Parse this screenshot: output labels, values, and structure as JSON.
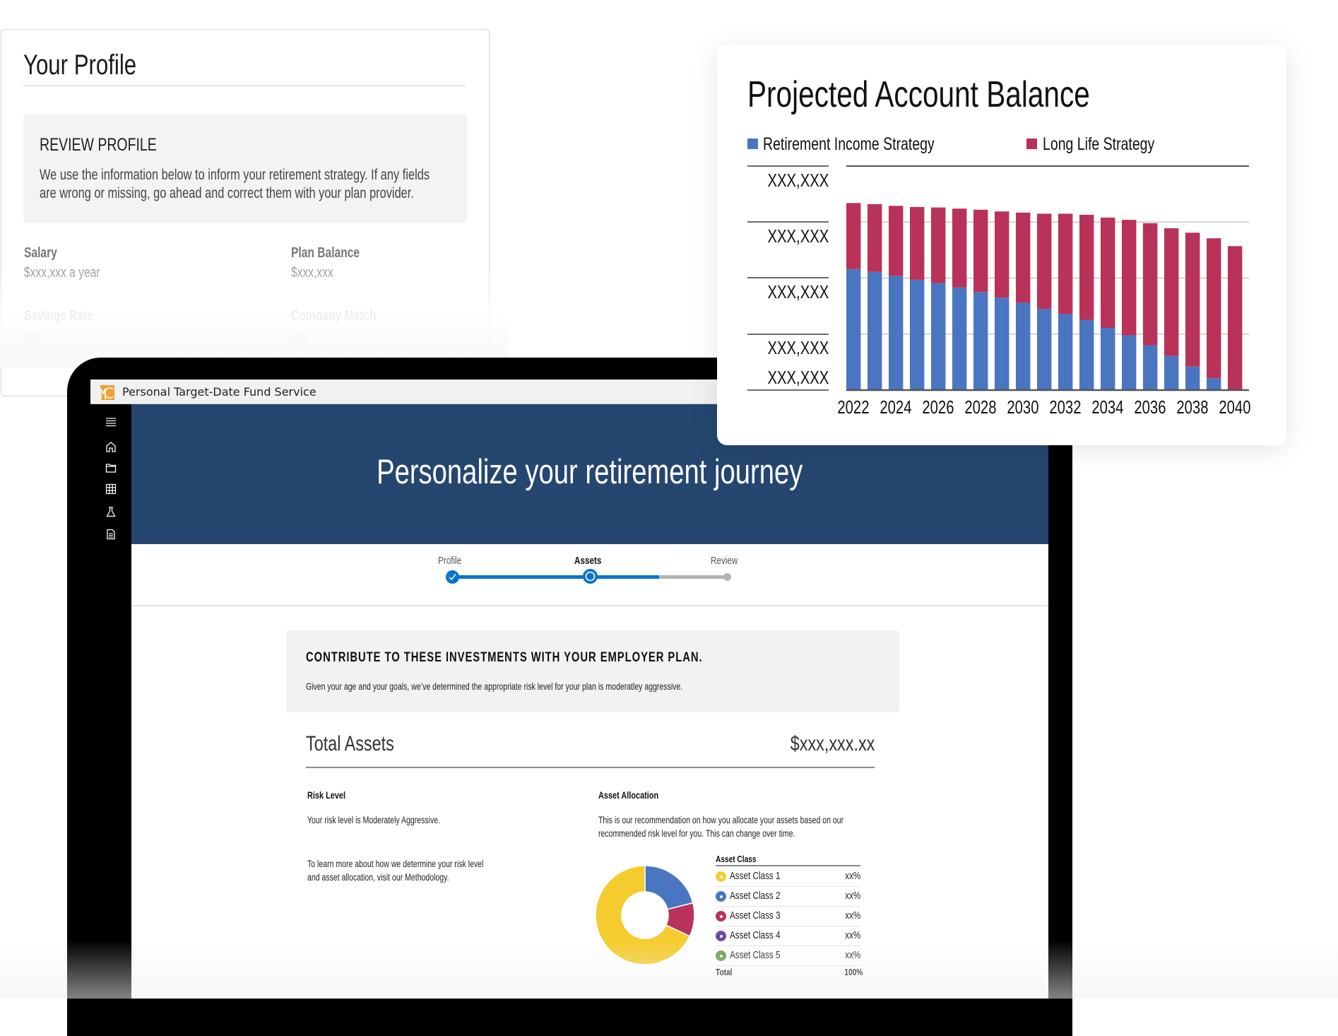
{
  "profile_card": {
    "title": "Your Profile",
    "review_title": "REVIEW PROFILE",
    "review_desc_line1": "We use the information below to inform your retirement strategy. If any fields",
    "review_desc_line2": "are wrong or missing, go ahead and correct them with your plan provider.",
    "fields": [
      {
        "label": "Salary",
        "value": "$xxx,xxx a year"
      },
      {
        "label": "Plan Balance",
        "value": "$xxx,xxx"
      },
      {
        "label": "Savings Rate",
        "value": "x%"
      },
      {
        "label": "Company Match",
        "value": "x%"
      }
    ]
  },
  "app": {
    "title": "Personal Target-Date Fund Service",
    "logo": "mc-logo",
    "sidebar_icons": [
      "menu-icon",
      "home-icon",
      "folder-icon",
      "grid-icon",
      "flask-icon",
      "document-icon"
    ],
    "hero_title": "Personalize your retirement journey",
    "stepper": {
      "steps": [
        {
          "label": "Profile",
          "state": "complete"
        },
        {
          "label": "Assets",
          "state": "current"
        },
        {
          "label": "Review",
          "state": "upcoming"
        }
      ],
      "progress_percent": 77
    },
    "contribute": {
      "title": "CONTRIBUTE TO THESE INVESTMENTS WITH YOUR EMPLOYER PLAN.",
      "desc": "Given your age and your goals, we’ve determined the appropriate risk level for your plan is moderatley aggressive."
    },
    "total_assets": {
      "label": "Total Assets",
      "value": "$xxx,xxx.xx"
    },
    "risk": {
      "title": "Risk Level",
      "text": "Your risk level is Moderately Aggressive.",
      "more_line1": "To learn more about how we determine your risk level",
      "more_line2": "and asset allocation, visit our Methodology."
    },
    "allocation": {
      "title": "Asset Allocation",
      "desc_line1": "This is our recommendation on how you allocate your assets based on our",
      "desc_line2": "recommended risk level for you. This can change over time.",
      "table_header": "Asset Class",
      "rows": [
        {
          "name": "Asset Class 1",
          "pct": "xx%",
          "color": "#f5cc2f"
        },
        {
          "name": "Asset Class 2",
          "pct": "xx%",
          "color": "#4a75c1"
        },
        {
          "name": "Asset Class 3",
          "pct": "xx%",
          "color": "#b83259"
        },
        {
          "name": "Asset Class 4",
          "pct": "xx%",
          "color": "#6a4aa6"
        },
        {
          "name": "Asset Class 5",
          "pct": "xx%",
          "color": "#6e9d4f"
        }
      ],
      "total_label": "Total",
      "total_value": "100%",
      "donut_shares": [
        {
          "name": "Asset Class 2",
          "share": 21,
          "color": "#4a75c1"
        },
        {
          "name": "Asset Class 3",
          "share": 11,
          "color": "#b83259"
        },
        {
          "name": "Asset Class 1",
          "share": 68,
          "color": "#f5cc2f"
        }
      ]
    }
  },
  "colors": {
    "hero": "#25466f",
    "accent": "#0a73cf",
    "blue_series": "#4a75c1",
    "red_series": "#b83259"
  },
  "chart_data": {
    "type": "bar",
    "stacked": true,
    "title": "Projected Account Balance",
    "xlabel": "",
    "ylabel": "",
    "x": [
      2022,
      2023,
      2024,
      2025,
      2026,
      2027,
      2028,
      2029,
      2030,
      2031,
      2032,
      2033,
      2034,
      2035,
      2036,
      2037,
      2038,
      2039,
      2040
    ],
    "x_tick_labels": [
      "2022",
      "2024",
      "2026",
      "2028",
      "2030",
      "2032",
      "2034",
      "2036",
      "2038",
      "2040"
    ],
    "y_tick_labels": [
      "XXX,XXX",
      "XXX,XXX",
      "XXX,XXX",
      "XXX,XXX",
      "XXX,XXX"
    ],
    "ylim": [
      0,
      4
    ],
    "y_unit_note": "values in gridline units (axis labels are placeholders)",
    "grid": true,
    "legend_position": "top",
    "series": [
      {
        "name": "Retirement Income Strategy",
        "color": "#4a75c1",
        "values": [
          2.16,
          2.11,
          2.04,
          1.97,
          1.91,
          1.83,
          1.75,
          1.65,
          1.56,
          1.45,
          1.36,
          1.25,
          1.11,
          0.98,
          0.8,
          0.61,
          0.42,
          0.21,
          0.0
        ]
      },
      {
        "name": "Long Life Strategy",
        "color": "#b83259",
        "values": [
          1.18,
          1.21,
          1.25,
          1.3,
          1.35,
          1.41,
          1.47,
          1.54,
          1.61,
          1.7,
          1.79,
          1.88,
          1.97,
          2.06,
          2.18,
          2.28,
          2.39,
          2.5,
          2.57
        ]
      }
    ]
  }
}
